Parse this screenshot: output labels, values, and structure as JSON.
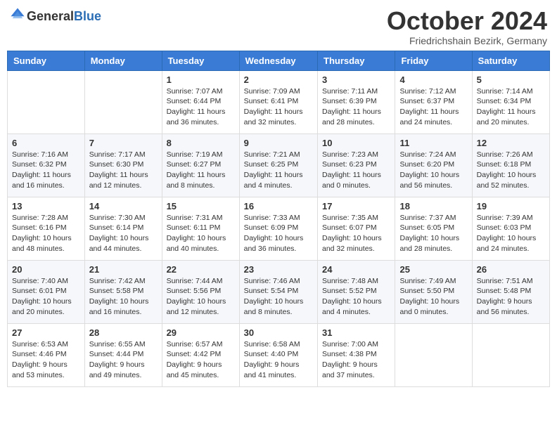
{
  "header": {
    "logo_general": "General",
    "logo_blue": "Blue",
    "month_title": "October 2024",
    "location": "Friedrichshain Bezirk, Germany"
  },
  "weekdays": [
    "Sunday",
    "Monday",
    "Tuesday",
    "Wednesday",
    "Thursday",
    "Friday",
    "Saturday"
  ],
  "weeks": [
    [
      {
        "day": "",
        "info": ""
      },
      {
        "day": "",
        "info": ""
      },
      {
        "day": "1",
        "info": "Sunrise: 7:07 AM\nSunset: 6:44 PM\nDaylight: 11 hours and 36 minutes."
      },
      {
        "day": "2",
        "info": "Sunrise: 7:09 AM\nSunset: 6:41 PM\nDaylight: 11 hours and 32 minutes."
      },
      {
        "day": "3",
        "info": "Sunrise: 7:11 AM\nSunset: 6:39 PM\nDaylight: 11 hours and 28 minutes."
      },
      {
        "day": "4",
        "info": "Sunrise: 7:12 AM\nSunset: 6:37 PM\nDaylight: 11 hours and 24 minutes."
      },
      {
        "day": "5",
        "info": "Sunrise: 7:14 AM\nSunset: 6:34 PM\nDaylight: 11 hours and 20 minutes."
      }
    ],
    [
      {
        "day": "6",
        "info": "Sunrise: 7:16 AM\nSunset: 6:32 PM\nDaylight: 11 hours and 16 minutes."
      },
      {
        "day": "7",
        "info": "Sunrise: 7:17 AM\nSunset: 6:30 PM\nDaylight: 11 hours and 12 minutes."
      },
      {
        "day": "8",
        "info": "Sunrise: 7:19 AM\nSunset: 6:27 PM\nDaylight: 11 hours and 8 minutes."
      },
      {
        "day": "9",
        "info": "Sunrise: 7:21 AM\nSunset: 6:25 PM\nDaylight: 11 hours and 4 minutes."
      },
      {
        "day": "10",
        "info": "Sunrise: 7:23 AM\nSunset: 6:23 PM\nDaylight: 11 hours and 0 minutes."
      },
      {
        "day": "11",
        "info": "Sunrise: 7:24 AM\nSunset: 6:20 PM\nDaylight: 10 hours and 56 minutes."
      },
      {
        "day": "12",
        "info": "Sunrise: 7:26 AM\nSunset: 6:18 PM\nDaylight: 10 hours and 52 minutes."
      }
    ],
    [
      {
        "day": "13",
        "info": "Sunrise: 7:28 AM\nSunset: 6:16 PM\nDaylight: 10 hours and 48 minutes."
      },
      {
        "day": "14",
        "info": "Sunrise: 7:30 AM\nSunset: 6:14 PM\nDaylight: 10 hours and 44 minutes."
      },
      {
        "day": "15",
        "info": "Sunrise: 7:31 AM\nSunset: 6:11 PM\nDaylight: 10 hours and 40 minutes."
      },
      {
        "day": "16",
        "info": "Sunrise: 7:33 AM\nSunset: 6:09 PM\nDaylight: 10 hours and 36 minutes."
      },
      {
        "day": "17",
        "info": "Sunrise: 7:35 AM\nSunset: 6:07 PM\nDaylight: 10 hours and 32 minutes."
      },
      {
        "day": "18",
        "info": "Sunrise: 7:37 AM\nSunset: 6:05 PM\nDaylight: 10 hours and 28 minutes."
      },
      {
        "day": "19",
        "info": "Sunrise: 7:39 AM\nSunset: 6:03 PM\nDaylight: 10 hours and 24 minutes."
      }
    ],
    [
      {
        "day": "20",
        "info": "Sunrise: 7:40 AM\nSunset: 6:01 PM\nDaylight: 10 hours and 20 minutes."
      },
      {
        "day": "21",
        "info": "Sunrise: 7:42 AM\nSunset: 5:58 PM\nDaylight: 10 hours and 16 minutes."
      },
      {
        "day": "22",
        "info": "Sunrise: 7:44 AM\nSunset: 5:56 PM\nDaylight: 10 hours and 12 minutes."
      },
      {
        "day": "23",
        "info": "Sunrise: 7:46 AM\nSunset: 5:54 PM\nDaylight: 10 hours and 8 minutes."
      },
      {
        "day": "24",
        "info": "Sunrise: 7:48 AM\nSunset: 5:52 PM\nDaylight: 10 hours and 4 minutes."
      },
      {
        "day": "25",
        "info": "Sunrise: 7:49 AM\nSunset: 5:50 PM\nDaylight: 10 hours and 0 minutes."
      },
      {
        "day": "26",
        "info": "Sunrise: 7:51 AM\nSunset: 5:48 PM\nDaylight: 9 hours and 56 minutes."
      }
    ],
    [
      {
        "day": "27",
        "info": "Sunrise: 6:53 AM\nSunset: 4:46 PM\nDaylight: 9 hours and 53 minutes."
      },
      {
        "day": "28",
        "info": "Sunrise: 6:55 AM\nSunset: 4:44 PM\nDaylight: 9 hours and 49 minutes."
      },
      {
        "day": "29",
        "info": "Sunrise: 6:57 AM\nSunset: 4:42 PM\nDaylight: 9 hours and 45 minutes."
      },
      {
        "day": "30",
        "info": "Sunrise: 6:58 AM\nSunset: 4:40 PM\nDaylight: 9 hours and 41 minutes."
      },
      {
        "day": "31",
        "info": "Sunrise: 7:00 AM\nSunset: 4:38 PM\nDaylight: 9 hours and 37 minutes."
      },
      {
        "day": "",
        "info": ""
      },
      {
        "day": "",
        "info": ""
      }
    ]
  ]
}
